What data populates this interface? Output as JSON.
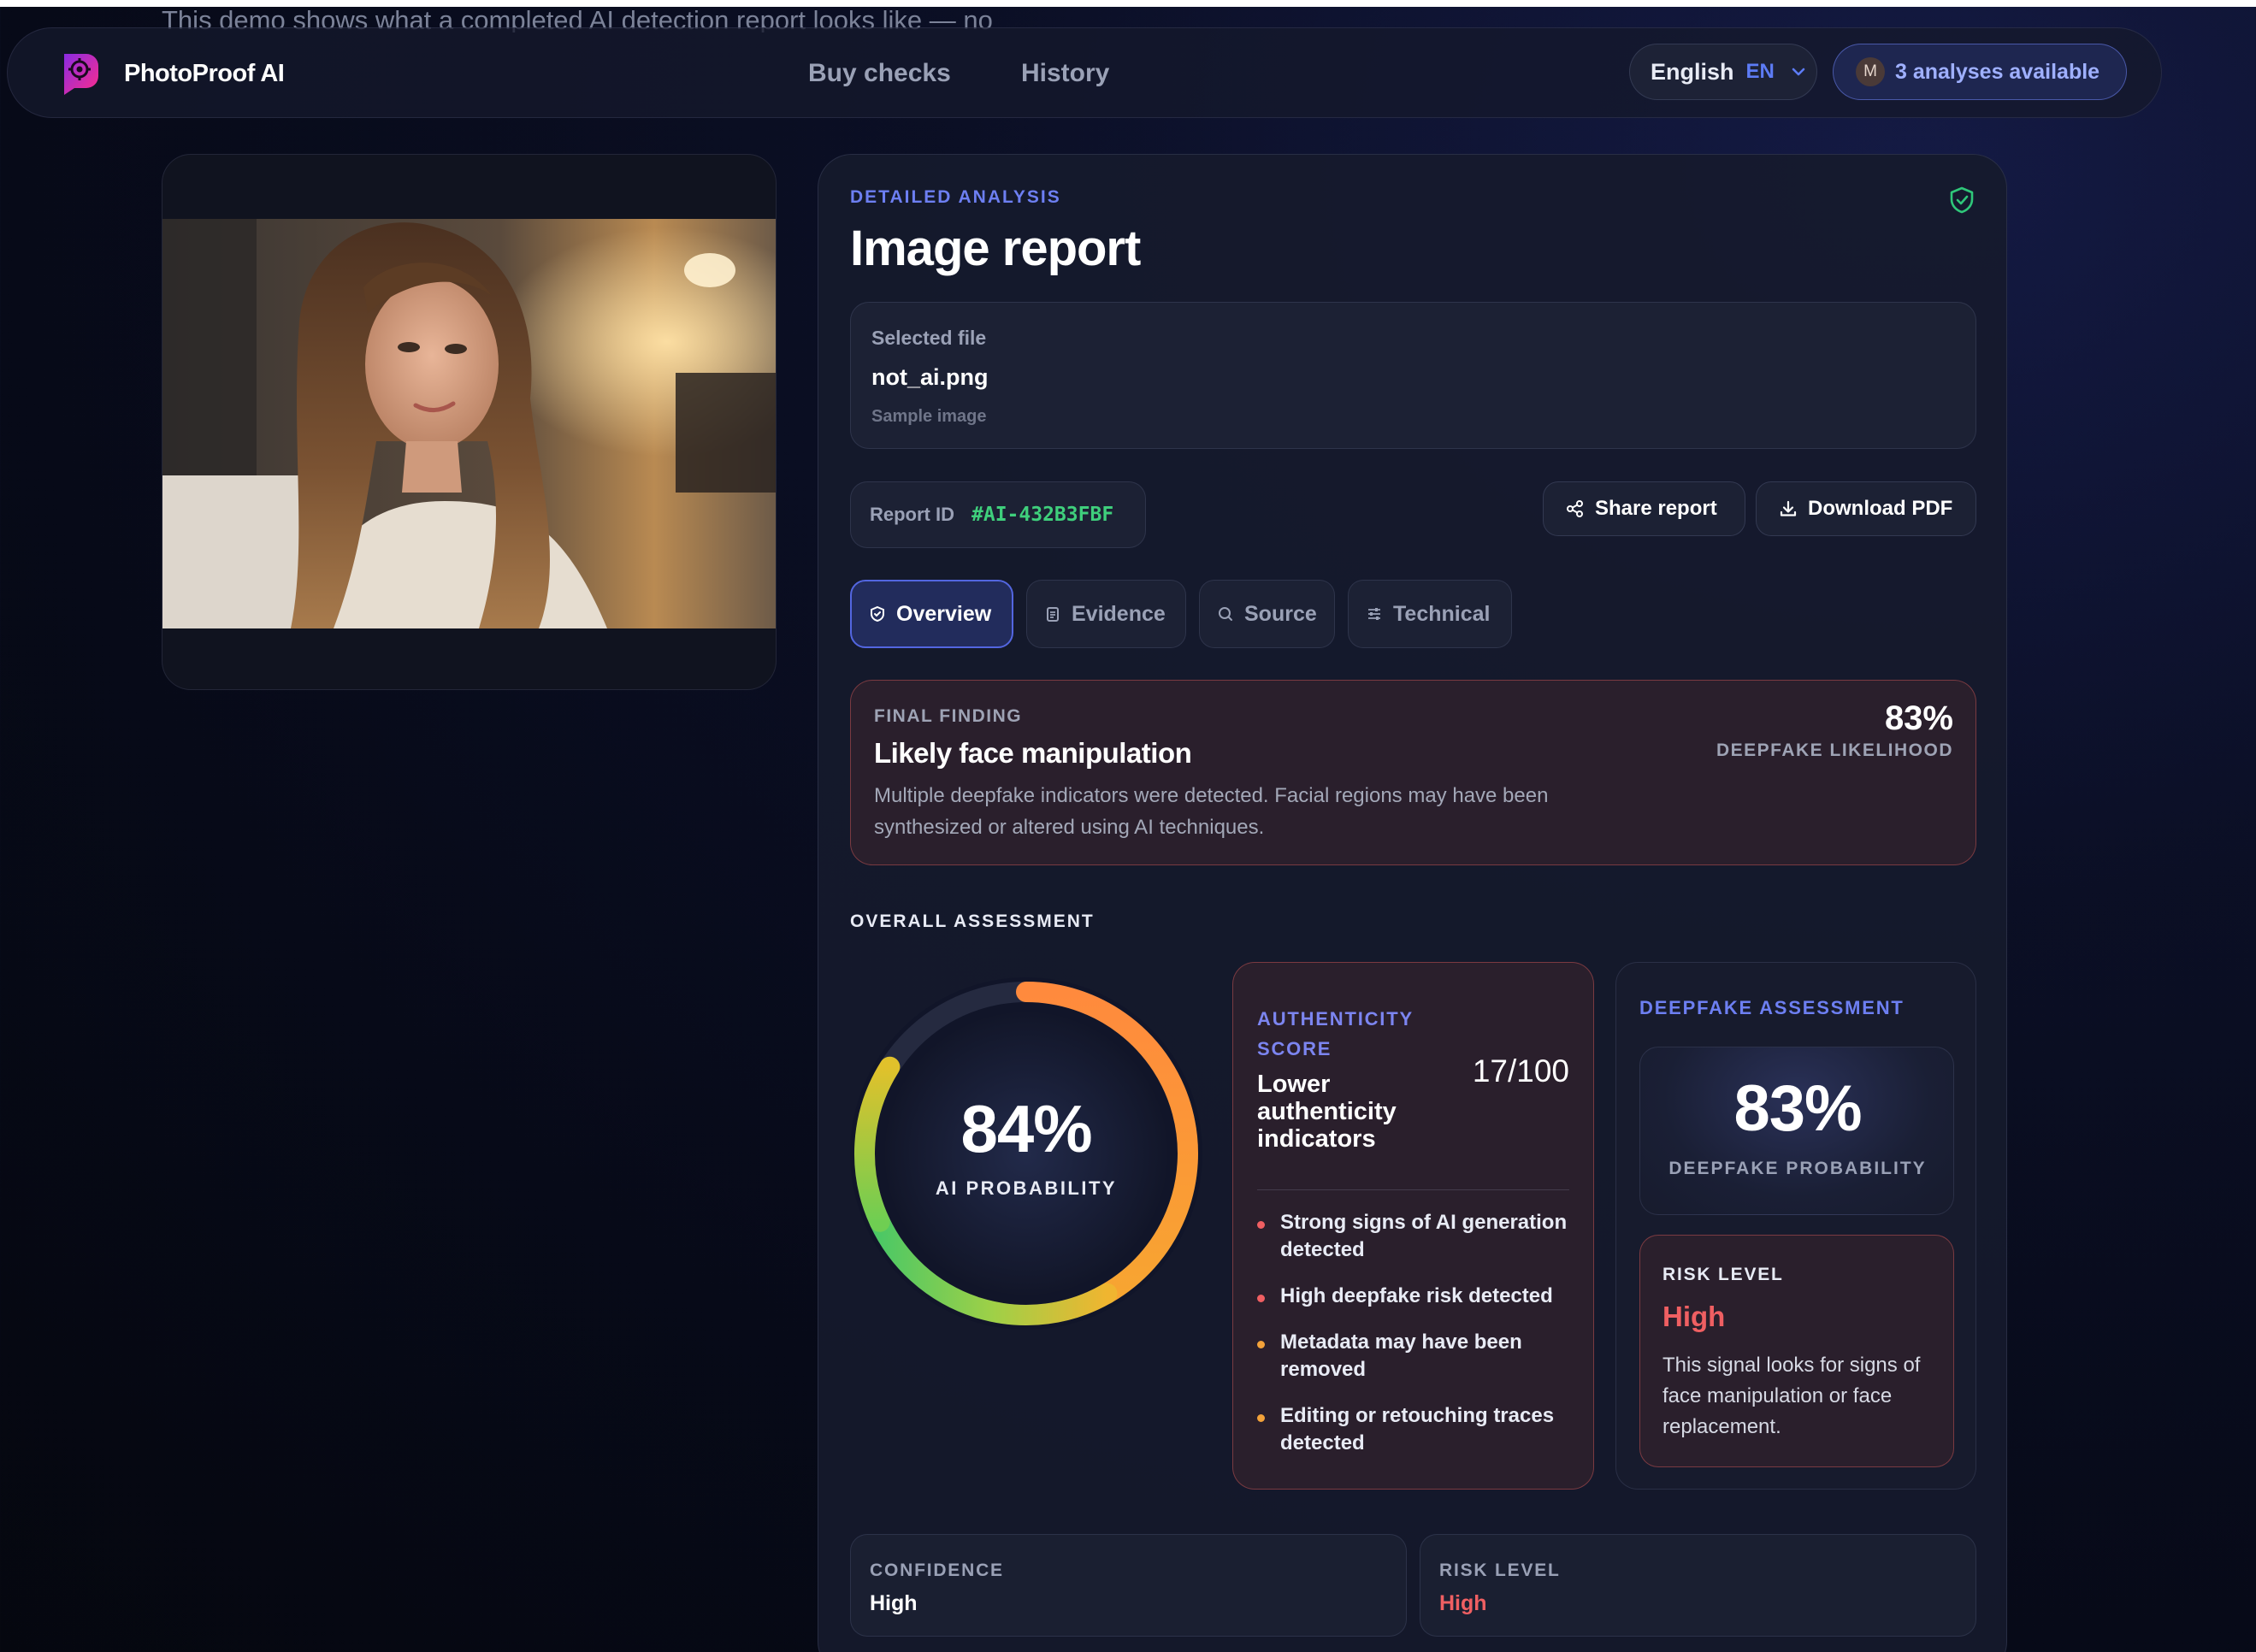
{
  "demo_banner": "This demo shows what a completed AI detection report looks like — no",
  "nav": {
    "brand": "PhotoProof AI",
    "links": [
      "Buy checks",
      "History"
    ],
    "language": "English",
    "language_code": "EN",
    "avatar_initial": "M",
    "credits": "3 analyses available"
  },
  "report": {
    "eyebrow": "DETAILED ANALYSIS",
    "title": "Image report",
    "file": {
      "label": "Selected file",
      "name": "not_ai.png",
      "sub": "Sample image"
    },
    "report_id_label": "Report ID",
    "report_id": "#AI-432B3FBF",
    "share_label": "Share report",
    "pdf_label": "Download PDF",
    "tabs": [
      "Overview",
      "Evidence",
      "Source",
      "Technical"
    ],
    "active_tab": "Overview",
    "finding": {
      "eyebrow": "FINAL FINDING",
      "heading": "Likely face manipulation",
      "description": "Multiple deepfake indicators were detected. Facial regions may have been synthesized or altered using AI techniques.",
      "percent": "83%",
      "percent_label": "DEEPFAKE LIKELIHOOD"
    },
    "overall_label": "OVERALL ASSESSMENT",
    "gauge": {
      "value": 84,
      "display": "84%",
      "label": "AI PROBABILITY"
    },
    "authenticity": {
      "eyebrow": "AUTHENTICITY SCORE",
      "score": "17/100",
      "heading": "Lower authenticity indicators",
      "items": [
        {
          "text": "Strong signs of AI generation detected",
          "color": "#ef5f62"
        },
        {
          "text": "High deepfake risk detected",
          "color": "#ef5f62"
        },
        {
          "text": "Metadata may have been removed",
          "color": "#f3a23a"
        },
        {
          "text": "Editing or retouching traces detected",
          "color": "#f3a23a"
        }
      ]
    },
    "deepfake": {
      "eyebrow": "DEEPFAKE ASSESSMENT",
      "value": "83%",
      "value_label": "DEEPFAKE PROBABILITY",
      "risk_label": "RISK LEVEL",
      "risk_value": "High",
      "risk_desc": "This signal looks for signs of face manipulation or face replacement."
    },
    "confidence": {
      "label": "CONFIDENCE",
      "value": "High"
    },
    "risk_summary": {
      "label": "RISK LEVEL",
      "value": "High"
    }
  },
  "colors": {
    "accent": "#6d7ff2",
    "success": "#3fcf7c",
    "danger": "#ef5f62",
    "warning": "#f3a23a"
  }
}
